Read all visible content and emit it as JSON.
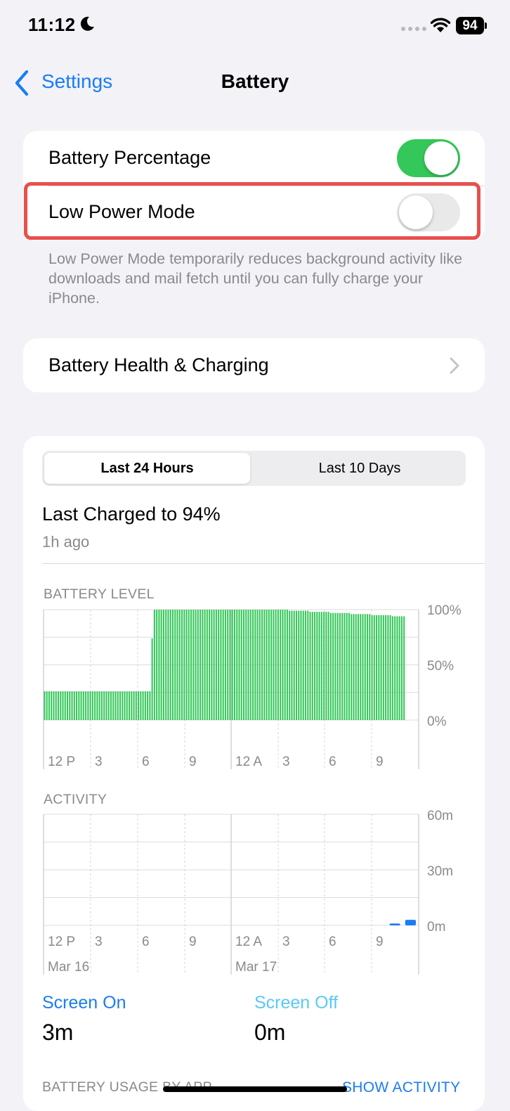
{
  "status_bar": {
    "time": "11:12",
    "battery": "94"
  },
  "nav": {
    "back_label": "Settings",
    "title": "Battery"
  },
  "settings": {
    "battery_percentage": {
      "label": "Battery Percentage",
      "on": true
    },
    "low_power_mode": {
      "label": "Low Power Mode",
      "on": false
    },
    "footer": "Low Power Mode temporarily reduces background activity like downloads and mail fetch until you can fully charge your iPhone."
  },
  "health": {
    "label": "Battery Health & Charging"
  },
  "usage": {
    "tabs": [
      {
        "label": "Last 24 Hours",
        "active": true
      },
      {
        "label": "Last 10 Days",
        "active": false
      }
    ],
    "last_charged": "Last Charged to 94%",
    "last_charged_ago": "1h ago",
    "screen_on_label": "Screen On",
    "screen_on_value": "3m",
    "screen_off_label": "Screen Off",
    "screen_off_value": "0m",
    "by_app_label": "BATTERY USAGE BY APP",
    "show_activity": "SHOW ACTIVITY"
  },
  "colors": {
    "accent": "#1a7cf5",
    "battery_bar": "#34c759",
    "screen_off": "#5ac8fa",
    "highlight": "#e8504a"
  },
  "chart_data": [
    {
      "type": "bar",
      "title": "BATTERY LEVEL",
      "x_tick_labels": [
        "12 P",
        "3",
        "6",
        "9",
        "12 A",
        "3",
        "6",
        "9"
      ],
      "y_tick_labels": [
        "100%",
        "50%",
        "0%"
      ],
      "ylim": [
        0,
        100
      ],
      "values": [
        26,
        26,
        26,
        26,
        26,
        26,
        26,
        26,
        26,
        26,
        26,
        26,
        26,
        26,
        26,
        26,
        26,
        26,
        26,
        26,
        26,
        26,
        26,
        26,
        26,
        26,
        26,
        26,
        26,
        26,
        26,
        26,
        26,
        26,
        26,
        26,
        26,
        26,
        26,
        26,
        26,
        26,
        26,
        26,
        26,
        26,
        26,
        74,
        100,
        100,
        100,
        100,
        100,
        100,
        100,
        100,
        100,
        100,
        100,
        100,
        100,
        100,
        100,
        100,
        100,
        100,
        100,
        100,
        100,
        100,
        100,
        100,
        100,
        100,
        100,
        100,
        100,
        100,
        100,
        100,
        100,
        100,
        100,
        100,
        100,
        100,
        100,
        100,
        100,
        100,
        100,
        100,
        100,
        100,
        100,
        100,
        100,
        100,
        100,
        100,
        100,
        100,
        100,
        100,
        100,
        100,
        100,
        99,
        99,
        99,
        99,
        99,
        99,
        99,
        99,
        99,
        98,
        98,
        98,
        98,
        98,
        98,
        98,
        98,
        98,
        97,
        97,
        97,
        97,
        97,
        97,
        97,
        97,
        97,
        96,
        96,
        96,
        96,
        96,
        96,
        96,
        96,
        96,
        95,
        95,
        95,
        95,
        95,
        95,
        95,
        95,
        95,
        94,
        94,
        94,
        94,
        94,
        94
      ]
    },
    {
      "type": "bar",
      "title": "ACTIVITY",
      "x_tick_labels": [
        "12 P",
        "3",
        "6",
        "9",
        "12 A",
        "3",
        "6",
        "9"
      ],
      "date_labels": [
        "Mar 16",
        "Mar 17"
      ],
      "y_tick_labels": [
        "60m",
        "30m",
        "0m"
      ],
      "ylim": [
        0,
        60
      ],
      "series": [
        {
          "values": [
            0,
            0,
            0,
            0,
            0,
            0,
            0,
            0,
            0,
            0,
            0,
            0,
            0,
            0,
            0,
            0,
            0,
            0,
            0,
            0,
            0,
            0,
            1,
            3
          ]
        }
      ]
    }
  ]
}
